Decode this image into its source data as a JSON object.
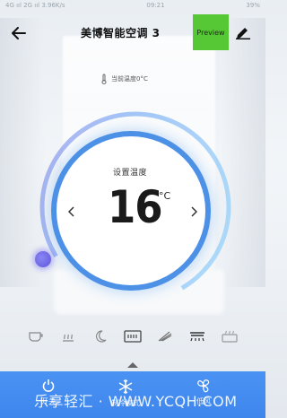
{
  "status_bar": {
    "left": "4G ııl 2G ııl 3.96K/s",
    "time": "09:21",
    "right": "39%"
  },
  "header": {
    "title": "美博智能空调 3",
    "preview_label": "Preview"
  },
  "current_temp": {
    "text": "当前温度0°C"
  },
  "dial": {
    "set_label": "设置温度",
    "value": "16",
    "unit": "°C"
  },
  "modes": [
    {
      "icon": "sleep-cup-icon"
    },
    {
      "icon": "heat-wave-icon"
    },
    {
      "icon": "moon-icon"
    },
    {
      "icon": "display-icon"
    },
    {
      "icon": "swing-icon"
    },
    {
      "icon": "vent-icon"
    },
    {
      "icon": "heater-icon"
    }
  ],
  "bottom": {
    "power_label": "开关",
    "mode_label": "制冷模式",
    "fan_label": "低风"
  },
  "watermark": "乐享轻汇 · WWW.YCQH.COM",
  "colors": {
    "accent": "#4a92f2",
    "preview_bg": "#56c735",
    "knob": "#6a66e6"
  }
}
